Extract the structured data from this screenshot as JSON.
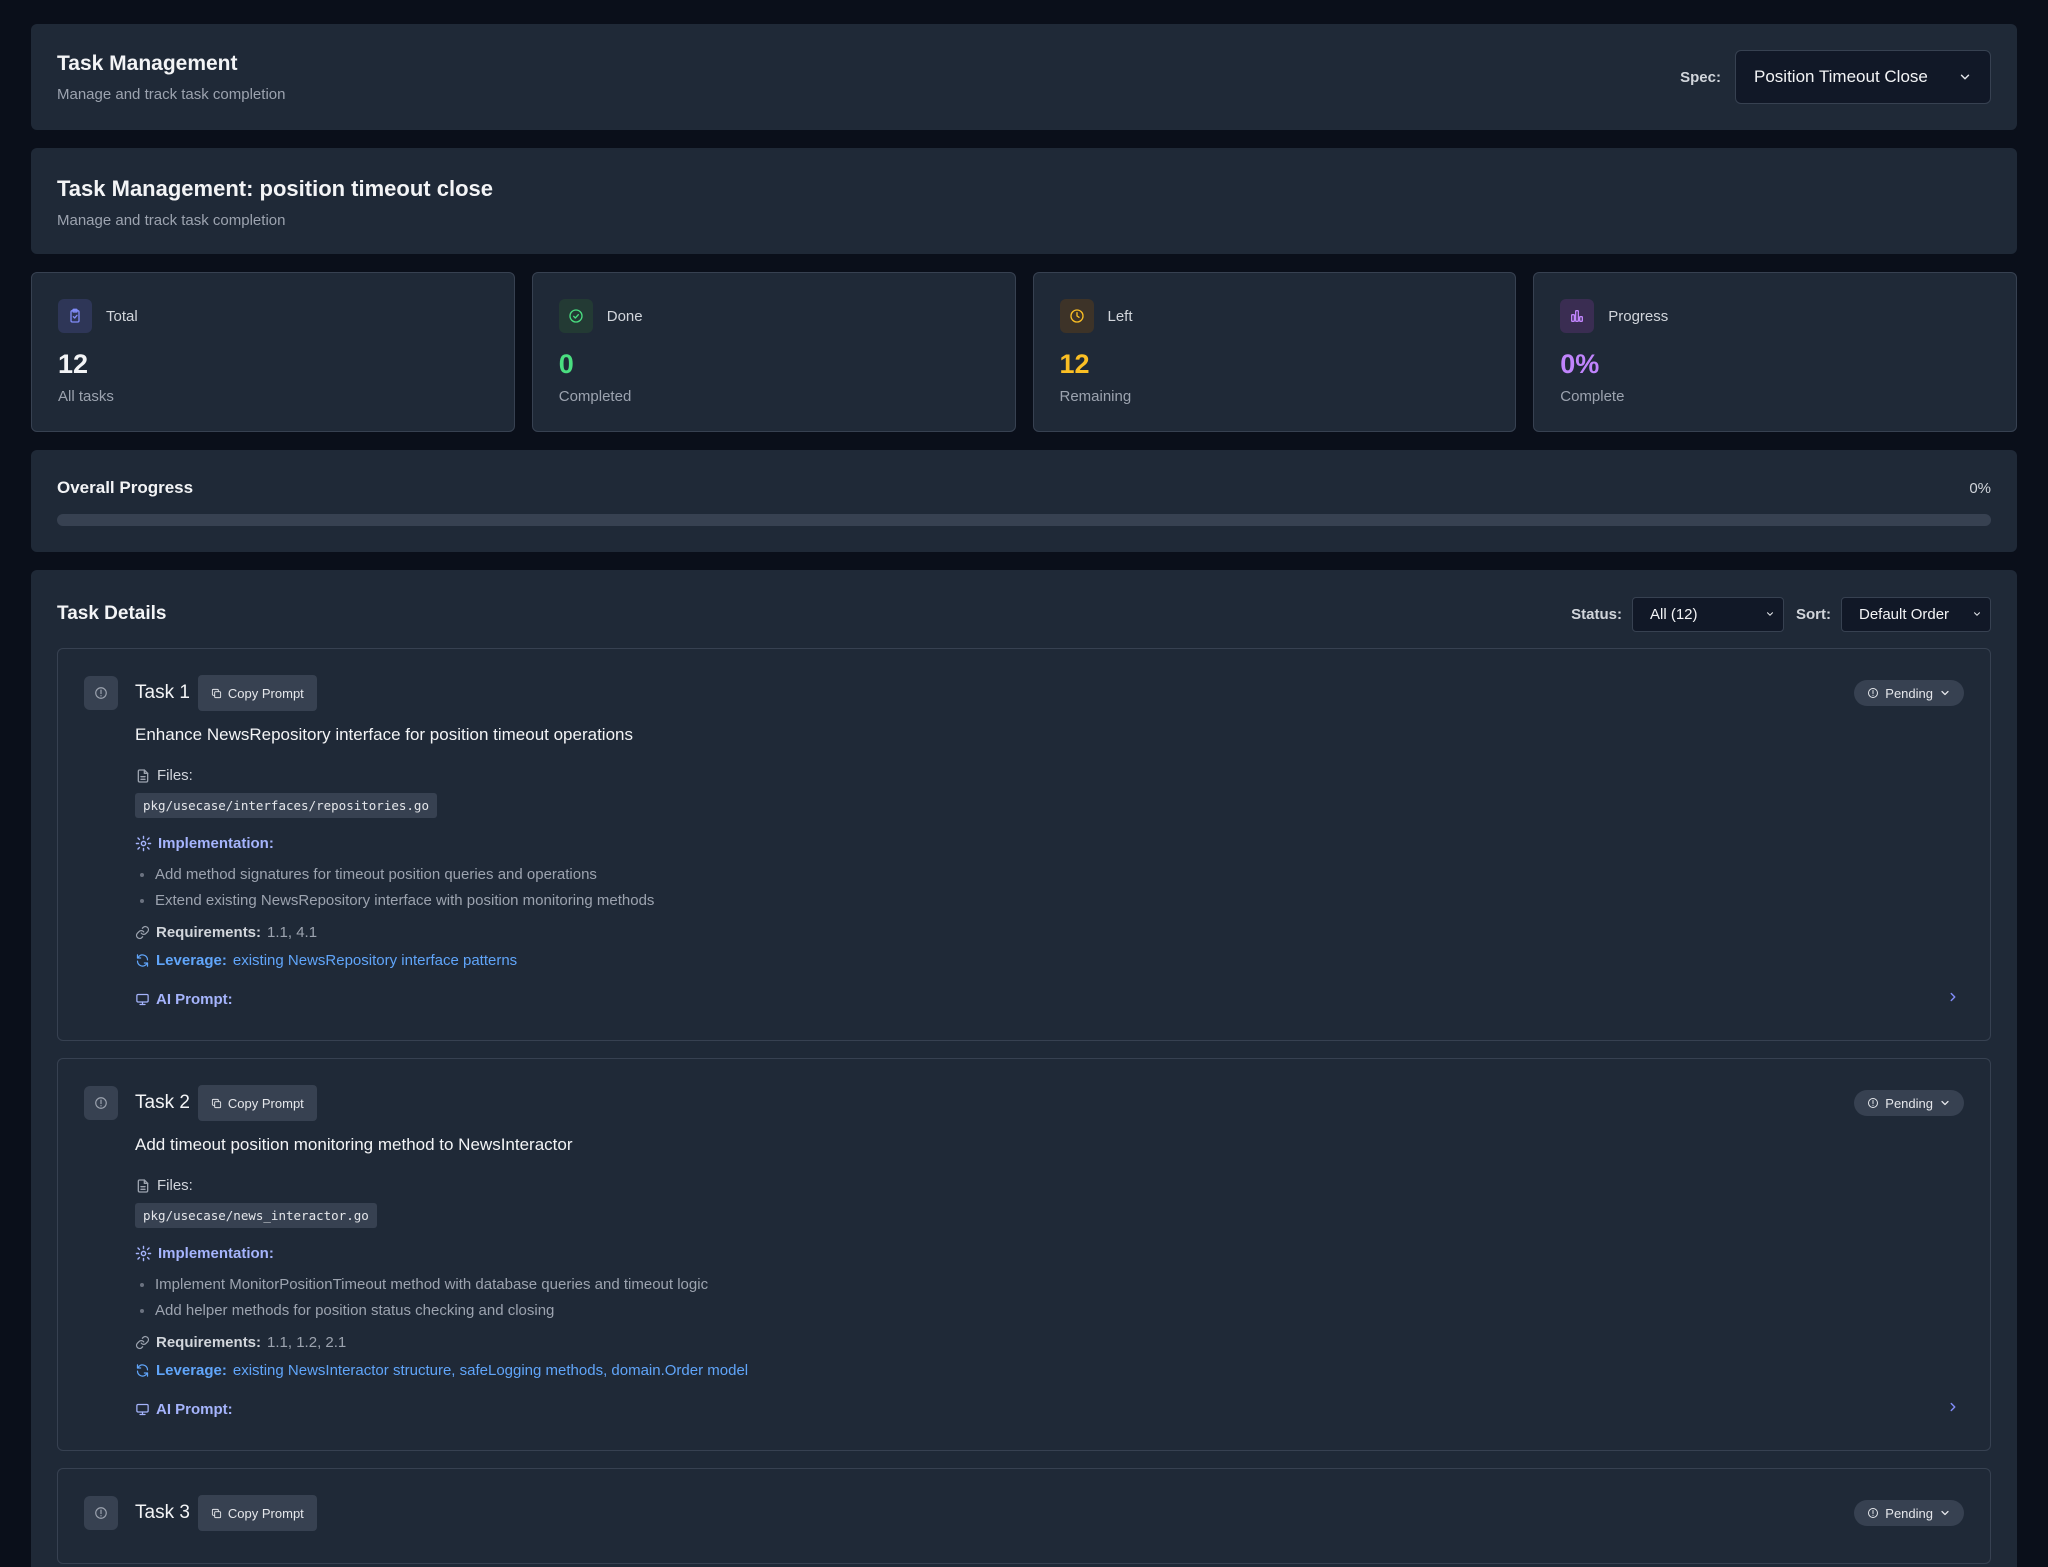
{
  "header": {
    "title": "Task Management",
    "subtitle": "Manage and track task completion",
    "spec_label": "Spec:",
    "spec_value": "Position Timeout Close"
  },
  "spec_section": {
    "title": "Task Management: position timeout close",
    "subtitle": "Manage and track task completion"
  },
  "stats": [
    {
      "label": "Total",
      "value": "12",
      "desc": "All tasks",
      "icon": "clipboard-icon",
      "color": "#818cf8",
      "bg": "#2e3657"
    },
    {
      "label": "Done",
      "value": "0",
      "desc": "Completed",
      "icon": "check-circle-icon",
      "color": "#4ade80",
      "bg": "#233a34"
    },
    {
      "label": "Left",
      "value": "12",
      "desc": "Remaining",
      "icon": "clock-icon",
      "color": "#fbbf24",
      "bg": "#3d3328"
    },
    {
      "label": "Progress",
      "value": "0%",
      "desc": "Complete",
      "icon": "bar-chart-icon",
      "color": "#c084fc",
      "bg": "#3a2d52"
    }
  ],
  "progress": {
    "title": "Overall Progress",
    "percent_label": "0%",
    "fraction": 0
  },
  "task_details": {
    "title": "Task Details",
    "status_label": "Status:",
    "status_value": "All (12)",
    "sort_label": "Sort:",
    "sort_value": "Default Order"
  },
  "labels": {
    "copy_prompt": "Copy Prompt",
    "pending": "Pending",
    "files": "Files:",
    "implementation": "Implementation:",
    "requirements": "Requirements:",
    "leverage": "Leverage:",
    "ai_prompt": "AI Prompt:"
  },
  "tasks": [
    {
      "name": "Task 1",
      "description": "Enhance NewsRepository interface for position timeout operations",
      "file": "pkg/usecase/interfaces/repositories.go",
      "implementation": [
        "Add method signatures for timeout position queries and operations",
        "Extend existing NewsRepository interface with position monitoring methods"
      ],
      "requirements": "1.1, 4.1",
      "leverage": "existing NewsRepository interface patterns"
    },
    {
      "name": "Task 2",
      "description": "Add timeout position monitoring method to NewsInteractor",
      "file": "pkg/usecase/news_interactor.go",
      "implementation": [
        "Implement MonitorPositionTimeout method with database queries and timeout logic",
        "Add helper methods for position status checking and closing"
      ],
      "requirements": "1.1, 1.2, 2.1",
      "leverage": "existing NewsInteractor structure, safeLogging methods, domain.Order model"
    },
    {
      "name": "Task 3"
    }
  ]
}
